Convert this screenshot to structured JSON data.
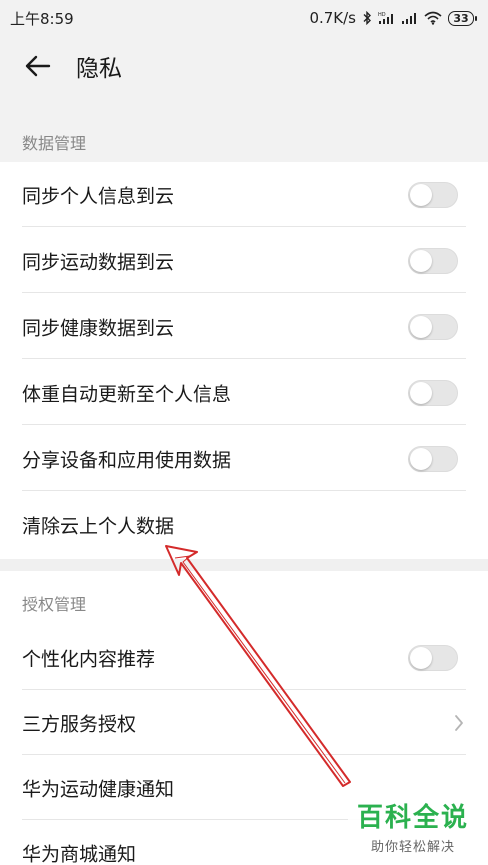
{
  "status_bar": {
    "time": "上午8:59",
    "network_speed": "0.7K/s",
    "battery": "33",
    "icons": [
      "bluetooth-icon",
      "hd-signal-icon",
      "signal-icon",
      "wifi-icon",
      "battery-icon"
    ]
  },
  "header": {
    "title": "隐私",
    "back_icon": "arrow-left-icon"
  },
  "sections": [
    {
      "title": "数据管理",
      "items": [
        {
          "label": "同步个人信息到云",
          "control": "toggle",
          "on": false
        },
        {
          "label": "同步运动数据到云",
          "control": "toggle",
          "on": false
        },
        {
          "label": "同步健康数据到云",
          "control": "toggle",
          "on": false
        },
        {
          "label": "体重自动更新至个人信息",
          "control": "toggle",
          "on": false
        },
        {
          "label": "分享设备和应用使用数据",
          "control": "toggle",
          "on": false
        },
        {
          "label": "清除云上个人数据",
          "control": "none"
        }
      ]
    },
    {
      "title": "授权管理",
      "items": [
        {
          "label": "个性化内容推荐",
          "control": "toggle",
          "on": false
        },
        {
          "label": "三方服务授权",
          "control": "chevron"
        },
        {
          "label": "华为运动健康通知",
          "control": "none"
        },
        {
          "label": "华为商城通知",
          "control": "none"
        }
      ]
    }
  ],
  "annotation": {
    "color": "#d42b2b"
  },
  "watermark": {
    "brand": "百科全说",
    "sub": "助你轻松解决",
    "color": "#2bb14f"
  },
  "colors": {
    "background": "#f2f2f2",
    "toggle_off": "#e6e6e6",
    "section_label": "#888888"
  }
}
